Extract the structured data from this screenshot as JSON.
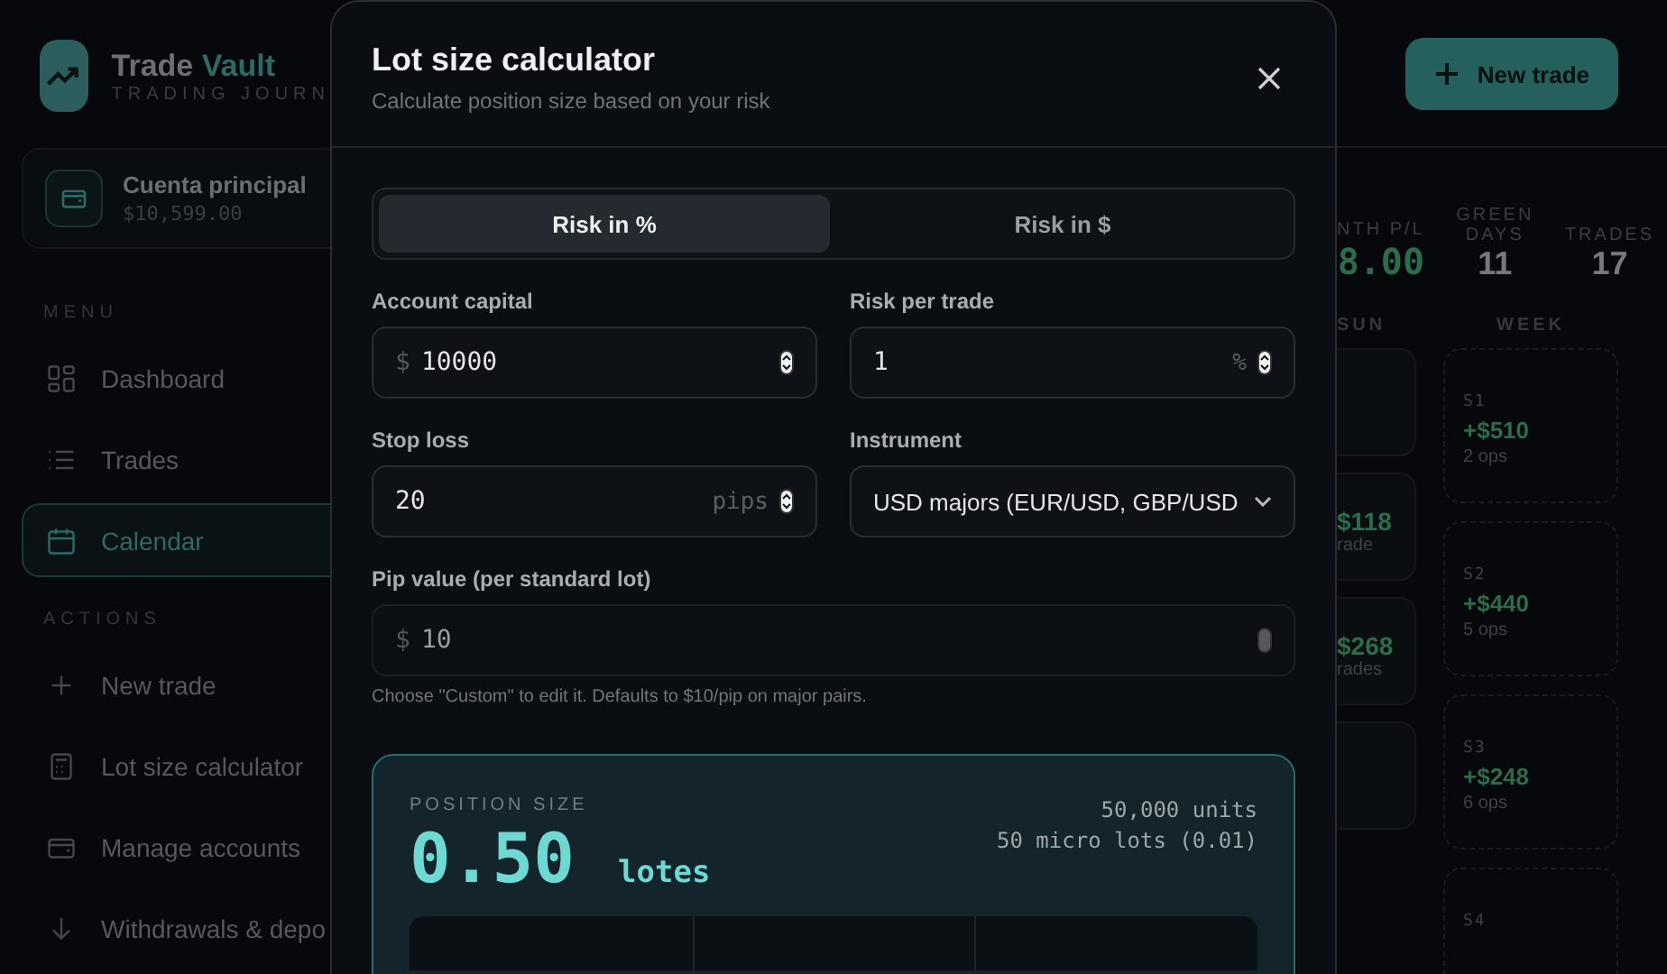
{
  "sidebar": {
    "brand": {
      "name": "Trade",
      "accent": "Vault",
      "tagline": "TRADING JOURN"
    },
    "account": {
      "name": "Cuenta principal",
      "balance": "$10,599.00"
    },
    "sections": [
      {
        "label": "MENU",
        "items": [
          {
            "label": "Dashboard",
            "selected": false
          },
          {
            "label": "Trades",
            "selected": false
          },
          {
            "label": "Calendar",
            "selected": true
          }
        ]
      },
      {
        "label": "ACTIONS",
        "items": [
          {
            "label": "New trade",
            "selected": false
          },
          {
            "label": "Lot size calculator",
            "selected": false
          },
          {
            "label": "Manage accounts",
            "selected": false
          },
          {
            "label": "Withdrawals & depo",
            "selected": false
          }
        ]
      }
    ]
  },
  "modal": {
    "title": "Lot size calculator",
    "subtitle": "Calculate position size based on your risk",
    "modes": [
      {
        "label": "Risk in %",
        "selected": true
      },
      {
        "label": "Risk in $",
        "selected": false
      }
    ],
    "fields": [
      {
        "kind": "number",
        "label": "Account capital",
        "prefix": "$",
        "value": "10000",
        "disabled": false
      },
      {
        "kind": "number",
        "label": "Risk per trade",
        "value": "1",
        "suffix": "%",
        "disabled": false
      },
      {
        "kind": "number",
        "label": "Stop loss",
        "value": "20",
        "suffix": "pips",
        "disabled": false
      },
      {
        "kind": "select",
        "label": "Instrument",
        "value": "USD majors (EUR/USD, GBP/USD"
      },
      {
        "kind": "number",
        "label": "Pip value (per standard lot)",
        "prefix": "$",
        "value": "10",
        "disabled": true
      }
    ],
    "hint": "Choose \"Custom\" to edit it. Defaults to $10/pip on major pairs.",
    "result": {
      "label": "POSITION SIZE",
      "value": "0.50",
      "unit": "lotes",
      "units": "50,000 units",
      "micro": "50 micro lots (0.01)"
    }
  },
  "main": {
    "new_trade_button": "New trade",
    "stats": [
      {
        "label": "NTH P/L",
        "value": "8.00",
        "kind": "money"
      },
      {
        "label": "GREEN DAYS",
        "value": "11",
        "kind": "count"
      },
      {
        "label": "TRADES",
        "value": "17",
        "kind": "count"
      }
    ],
    "sun_header": "SUN",
    "week_header": "WEEK",
    "sun_cells": [
      {},
      {
        "amount": "$118",
        "note": "rade"
      },
      {
        "amount": "$268",
        "note": "rades"
      },
      {}
    ],
    "weeks": [
      {
        "label": "S1",
        "amount": "+$510",
        "ops": "2 ops"
      },
      {
        "label": "S2",
        "amount": "+$440",
        "ops": "5 ops"
      },
      {
        "label": "S3",
        "amount": "+$248",
        "ops": "6 ops"
      },
      {
        "label": "S4"
      }
    ]
  }
}
